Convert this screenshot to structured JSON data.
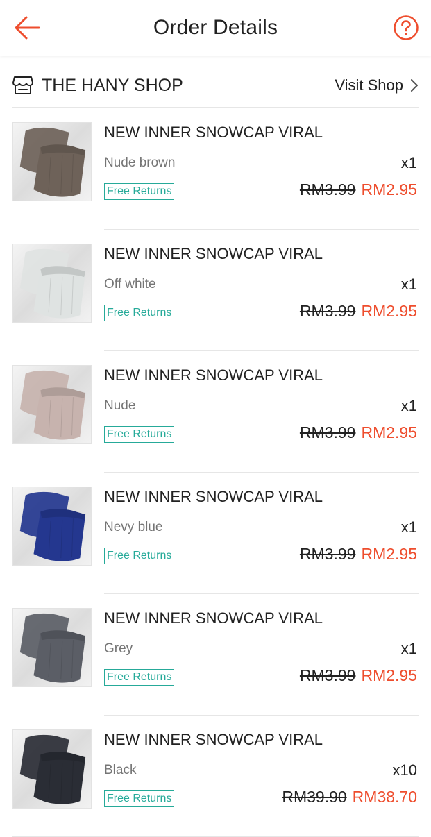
{
  "header": {
    "title": "Order Details",
    "back_icon": "arrow-left-icon",
    "help_icon": "question-circle-icon",
    "accent": "#ee4d2d"
  },
  "shop": {
    "name": "THE HANY SHOP",
    "visit_label": "Visit Shop",
    "icon": "shop-icon"
  },
  "items": [
    {
      "name": "NEW INNER SNOWCAP VIRAL",
      "variant": "Nude brown",
      "qty": "x1",
      "badge": "Free Returns",
      "old_price": "RM3.99",
      "new_price": "RM2.95",
      "color": "#6e6259"
    },
    {
      "name": "NEW INNER SNOWCAP VIRAL",
      "variant": "Off white",
      "qty": "x1",
      "badge": "Free Returns",
      "old_price": "RM3.99",
      "new_price": "RM2.95",
      "color": "#dfe3e2"
    },
    {
      "name": "NEW INNER SNOWCAP VIRAL",
      "variant": "Nude",
      "qty": "x1",
      "badge": "Free Returns",
      "old_price": "RM3.99",
      "new_price": "RM2.95",
      "color": "#c7b3ae"
    },
    {
      "name": "NEW INNER SNOWCAP VIRAL",
      "variant": "Nevy blue",
      "qty": "x1",
      "badge": "Free Returns",
      "old_price": "RM3.99",
      "new_price": "RM2.95",
      "color": "#24378f"
    },
    {
      "name": "NEW INNER SNOWCAP VIRAL",
      "variant": "Grey",
      "qty": "x1",
      "badge": "Free Returns",
      "old_price": "RM3.99",
      "new_price": "RM2.95",
      "color": "#5b5e66"
    },
    {
      "name": "NEW INNER SNOWCAP VIRAL",
      "variant": "Black",
      "qty": "x10",
      "badge": "Free Returns",
      "old_price": "RM39.90",
      "new_price": "RM38.70",
      "color": "#2a2d35"
    }
  ]
}
